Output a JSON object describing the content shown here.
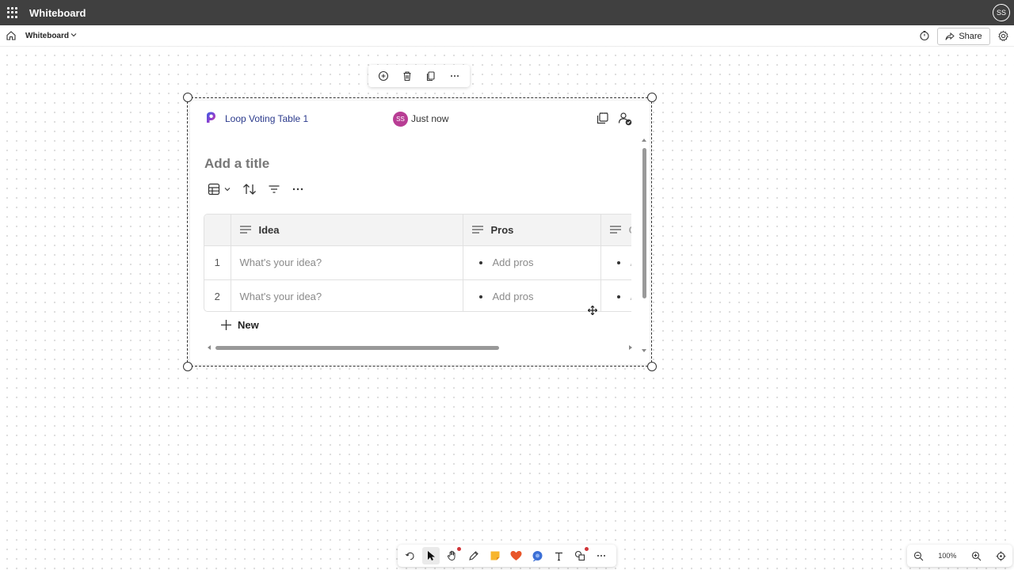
{
  "app": {
    "title": "Whiteboard",
    "user_initials": "SS"
  },
  "commandbar": {
    "board_name": "Whiteboard",
    "share_label": "Share"
  },
  "loop": {
    "name": "Loop Voting Table 1",
    "user_initials": "SS",
    "edited": "Just now",
    "title_placeholder": "Add a title",
    "columns": [
      "Idea",
      "Pros",
      "C"
    ],
    "rows": [
      {
        "num": "1",
        "idea": "What's your idea?",
        "pros": "Add pros",
        "cons": "A"
      },
      {
        "num": "2",
        "idea": "What's your idea?",
        "pros": "Add pros",
        "cons": "A"
      }
    ],
    "new_label": "New"
  },
  "zoom": {
    "level": "100%"
  },
  "colors": {
    "titlebar": "#404040",
    "loop_accent": "#2b3a8c",
    "avatar": "#b83d94",
    "sticky": "#f7b52c",
    "reaction": "#e8562a",
    "loop_bubble": "#3b6fd6"
  }
}
